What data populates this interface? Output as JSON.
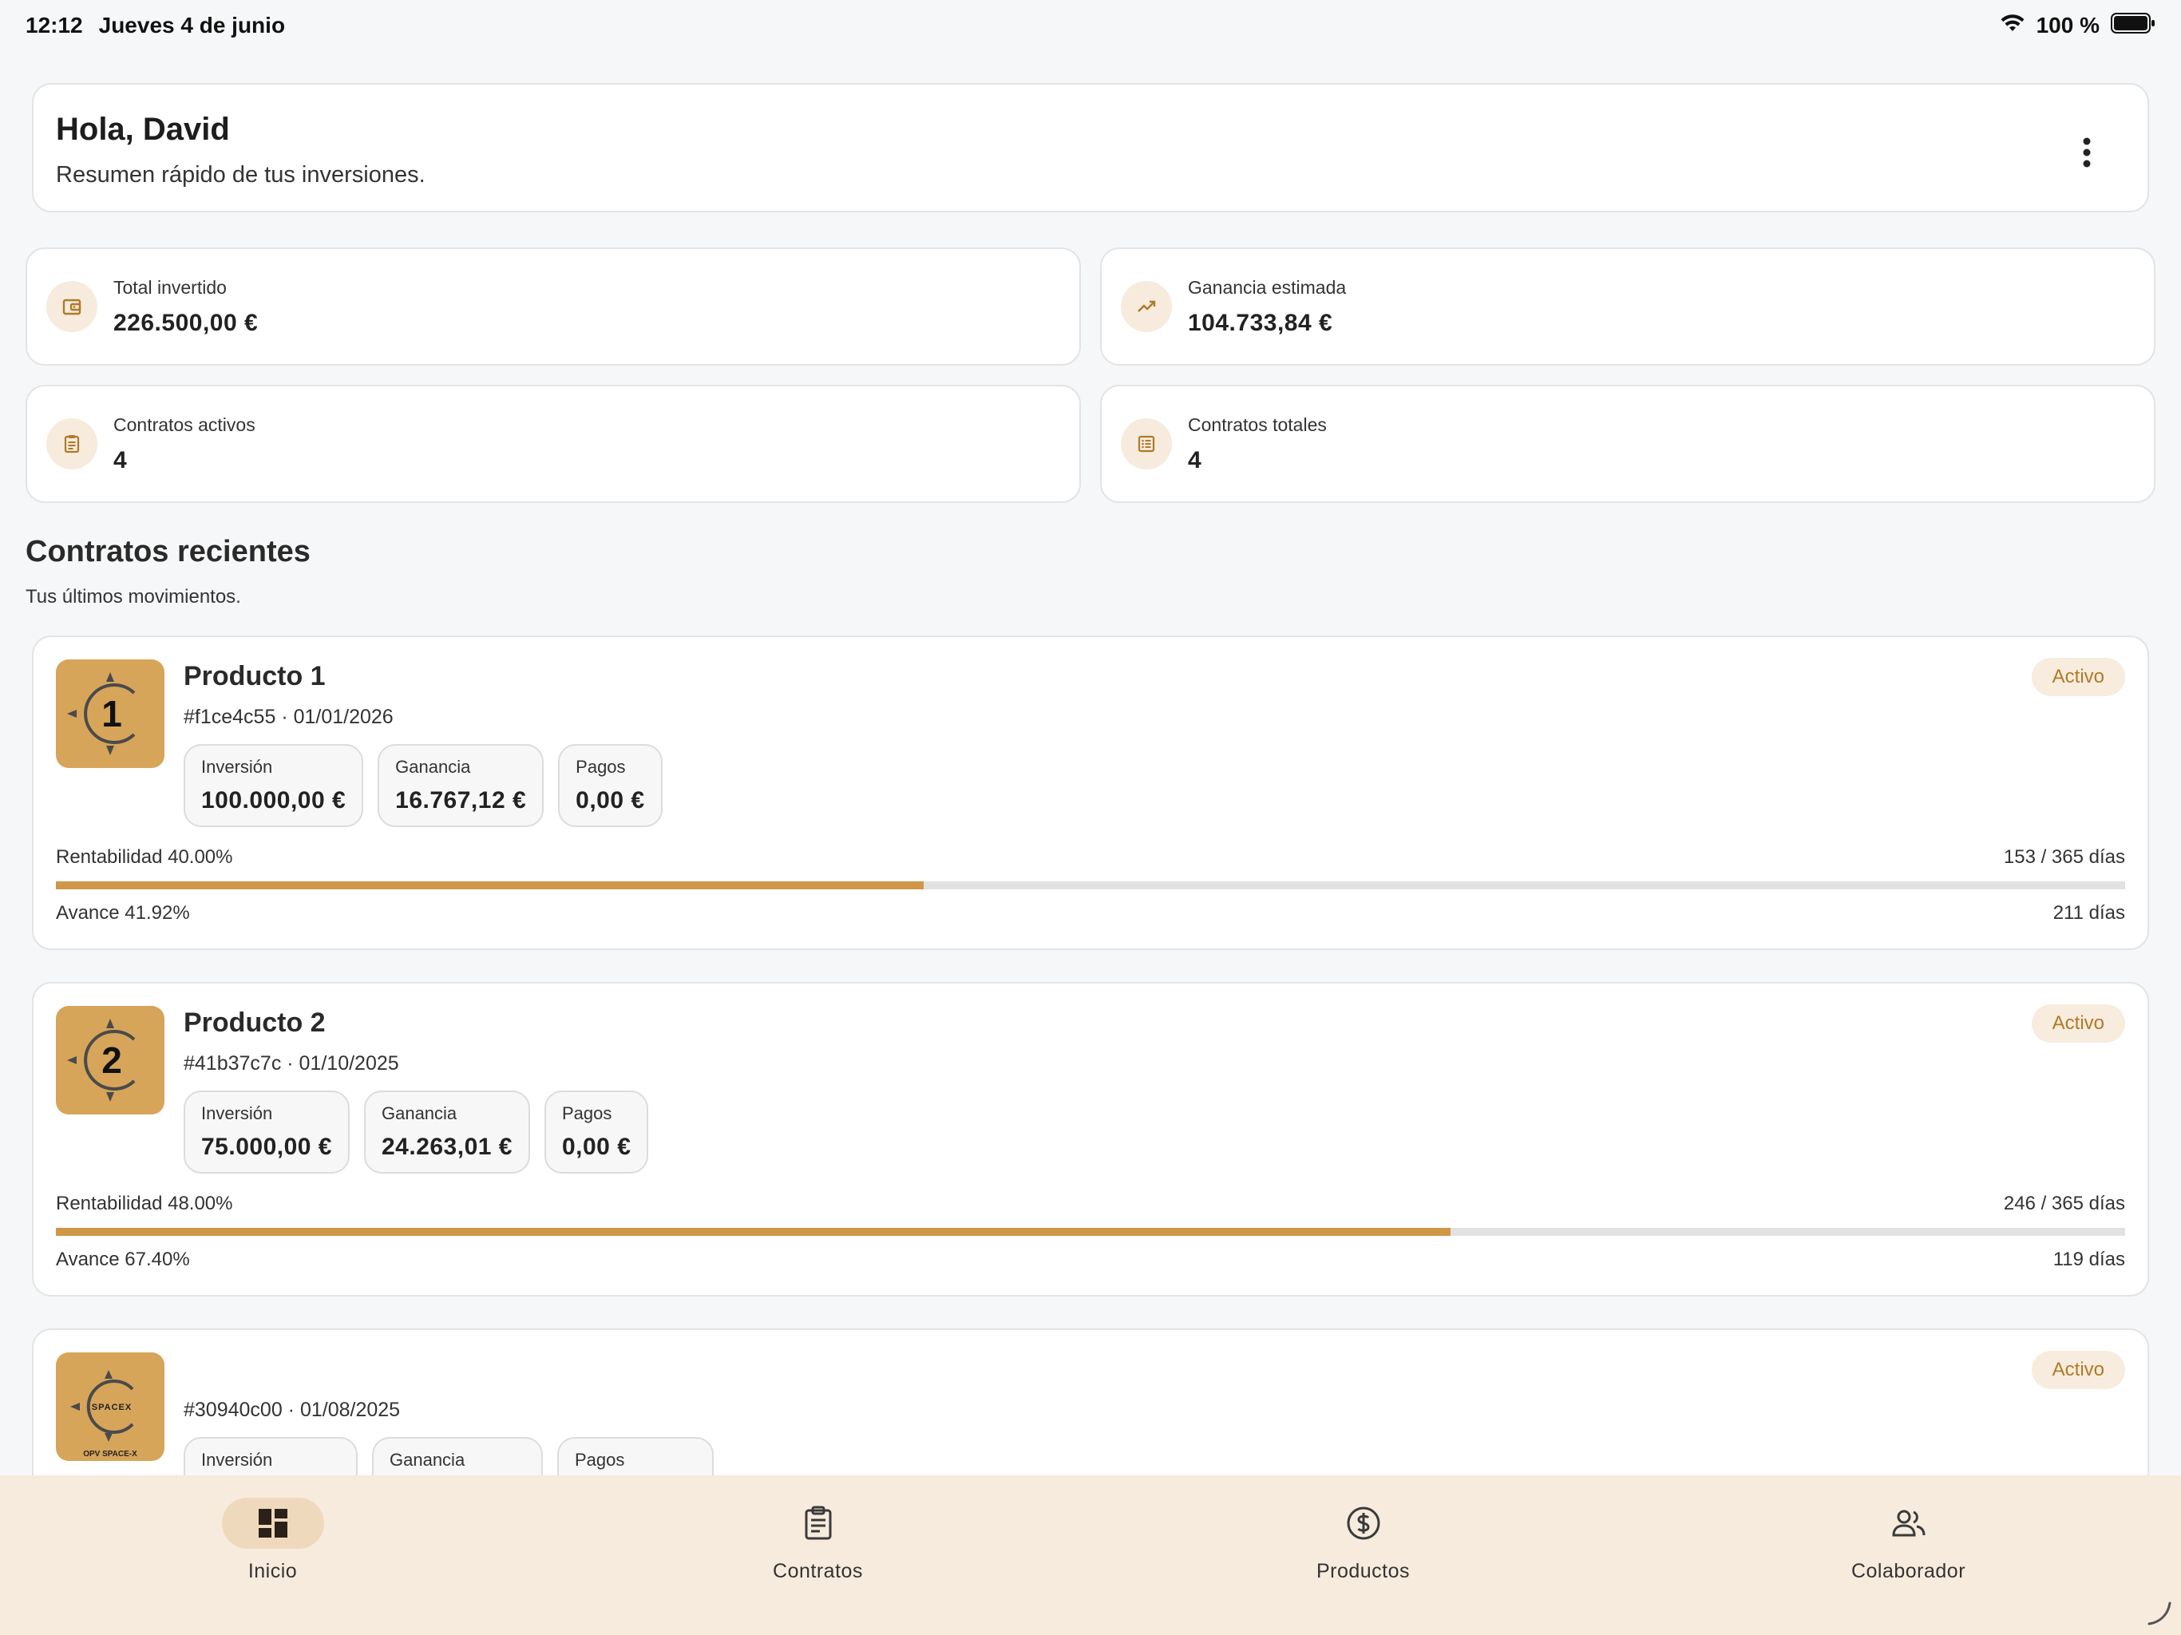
{
  "status_bar": {
    "time": "12:12",
    "date": "Jueves 4 de junio",
    "battery": "100 %"
  },
  "greeting": {
    "title": "Hola, David",
    "subtitle": "Resumen rápido de tus inversiones."
  },
  "stats": [
    {
      "label": "Total invertido",
      "value": "226.500,00 €",
      "icon": "wallet-icon"
    },
    {
      "label": "Ganancia estimada",
      "value": "104.733,84 €",
      "icon": "trending-up-icon"
    },
    {
      "label": "Contratos activos",
      "value": "4",
      "icon": "clipboard-icon"
    },
    {
      "label": "Contratos totales",
      "value": "4",
      "icon": "list-icon"
    }
  ],
  "section": {
    "title": "Contratos recientes",
    "subtitle": "Tus últimos movimientos."
  },
  "contracts": [
    {
      "title": "Producto 1",
      "id": "#f1ce4c55",
      "date": "01/01/2026",
      "meta": "#f1ce4c55 · 01/01/2026",
      "status": "Activo",
      "logo_text": "1",
      "pills": [
        {
          "label": "Inversión",
          "value": "100.000,00 €"
        },
        {
          "label": "Ganancia",
          "value": "16.767,12 €"
        },
        {
          "label": "Pagos",
          "value": "0,00 €"
        }
      ],
      "rentabilidad": "Rentabilidad 40.00%",
      "days": "153 / 365 días",
      "avance": "Avance 41.92%",
      "remaining": "211 días",
      "progress": 0.4192
    },
    {
      "title": "Producto 2",
      "id": "#41b37c7c",
      "date": "01/10/2025",
      "meta": "#41b37c7c · 01/10/2025",
      "status": "Activo",
      "logo_text": "2",
      "pills": [
        {
          "label": "Inversión",
          "value": "75.000,00 €"
        },
        {
          "label": "Ganancia",
          "value": "24.263,01 €"
        },
        {
          "label": "Pagos",
          "value": "0,00 €"
        }
      ],
      "rentabilidad": "Rentabilidad 48.00%",
      "days": "246 / 365 días",
      "avance": "Avance 67.40%",
      "remaining": "119 días",
      "progress": 0.674
    },
    {
      "title": "",
      "id": "#30940c00",
      "date": "01/08/2025",
      "meta": "#30940c00 · 01/08/2025",
      "status": "Activo",
      "logo_text": "SPACEX",
      "logo_caption": "OPV SPACE-X",
      "pills": [
        {
          "label": "Inversión"
        },
        {
          "label": "Ganancia"
        },
        {
          "label": "Pagos"
        }
      ]
    }
  ],
  "nav": [
    {
      "label": "Inicio",
      "icon": "dashboard-icon",
      "active": true
    },
    {
      "label": "Contratos",
      "icon": "clipboard-icon",
      "active": false
    },
    {
      "label": "Productos",
      "icon": "dollar-circle-icon",
      "active": false
    },
    {
      "label": "Colaborador",
      "icon": "people-icon",
      "active": false
    }
  ],
  "colors": {
    "accent": "#cf9747",
    "logo_bg": "#d6a55a",
    "nav_bg": "#f7ebdd",
    "badge_text": "#b07a27"
  }
}
